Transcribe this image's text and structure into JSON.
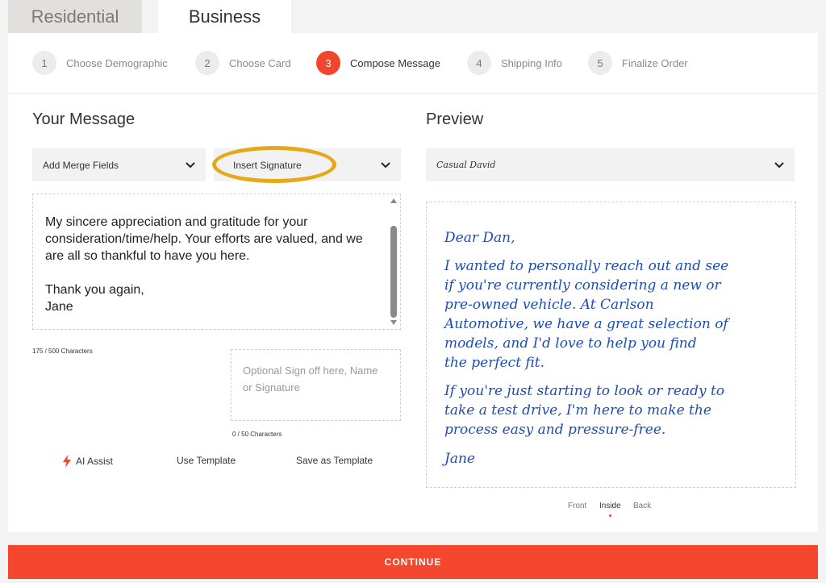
{
  "tabs": {
    "residential": "Residential",
    "business": "Business"
  },
  "steps": [
    {
      "num": "1",
      "label": "Choose Demographic"
    },
    {
      "num": "2",
      "label": "Choose Card"
    },
    {
      "num": "3",
      "label": "Compose Message"
    },
    {
      "num": "4",
      "label": "Shipping Info"
    },
    {
      "num": "5",
      "label": "Finalize Order"
    }
  ],
  "message": {
    "title": "Your Message",
    "merge_fields_label": "Add Merge Fields",
    "insert_signature_label": "Insert Signature",
    "body": "My sincere appreciation and gratitude for your consideration/time/help. Your efforts are valued, and we are all so thankful to have you here.\n\nThank you again,\nJane",
    "char_count": "175 / 500 Characters",
    "signoff_placeholder": "Optional Sign off here, Name or Signature",
    "signoff_count": "0 / 50 Characters",
    "ai_assist": "AI Assist",
    "use_template": "Use Template",
    "save_template": "Save as Template"
  },
  "preview": {
    "title": "Preview",
    "font": "Casual David",
    "greeting": "Dear Dan,",
    "para1": "I wanted to personally reach out and see\nif you're currently considering a new or\npre-owned vehicle. At Carlson\nAutomotive, we have a great selection of\nmodels, and I'd love to help you find\nthe perfect fit.",
    "para2": "If you're just starting to look or ready to\ntake a test drive, I'm here to make the\nprocess easy and pressure-free.",
    "signature": "Jane",
    "views": {
      "front": "Front",
      "inside": "Inside",
      "back": "Back"
    }
  },
  "continue_label": "CONTINUE",
  "colors": {
    "accent": "#f2462c",
    "highlight": "#e6a817",
    "ink": "#1d4eb0"
  }
}
